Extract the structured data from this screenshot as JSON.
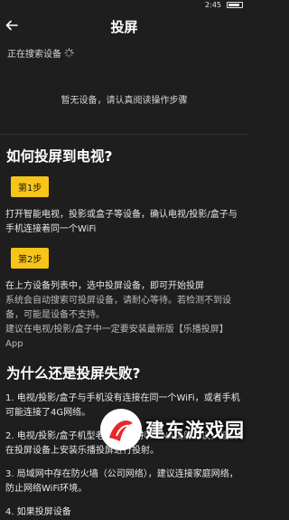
{
  "status_bar": {
    "time": "2:45"
  },
  "header": {
    "title": "投屏"
  },
  "scan": {
    "text": "正在搜索设备"
  },
  "empty_state": {
    "text": "暂无设备，请认真阅读操作步骤"
  },
  "guide": {
    "title": "如何投屏到电视?",
    "step1_label": "第1步",
    "step1_text": "打开智能电视，投影或盒子等设备，确认电视/投影/盒子与手机连接着同一个WiFi",
    "step2_label": "第2步",
    "step2_text": "在上方设备列表中，选中投屏设备，即可开始投屏",
    "step2_note": "系统会自动搜索可投屏设备，请耐心等待。若检测不到设备，可能是设备不支持。",
    "step2_tip": "建议在电视/投影/盒子中一定要安装最新版【乐播投屏】App"
  },
  "why": {
    "title": "为什么还是投屏失败?",
    "items": [
      "1. 电视/投影/盒子与手机没有连接在同一个WiFi，或者手机可能连接了4G网络。",
      "2. 电视/投影/盒子机型老旧，不支持DLNA投射协议，建议在投屏设备上安装乐播投屏进行投射。",
      "3. 局域网中存在防火墙（公司网络），建议连接家庭网络，防止网络WiFi环境。",
      "4. 如果投屏设备"
    ]
  },
  "watermark": {
    "text": "建东游戏园"
  }
}
